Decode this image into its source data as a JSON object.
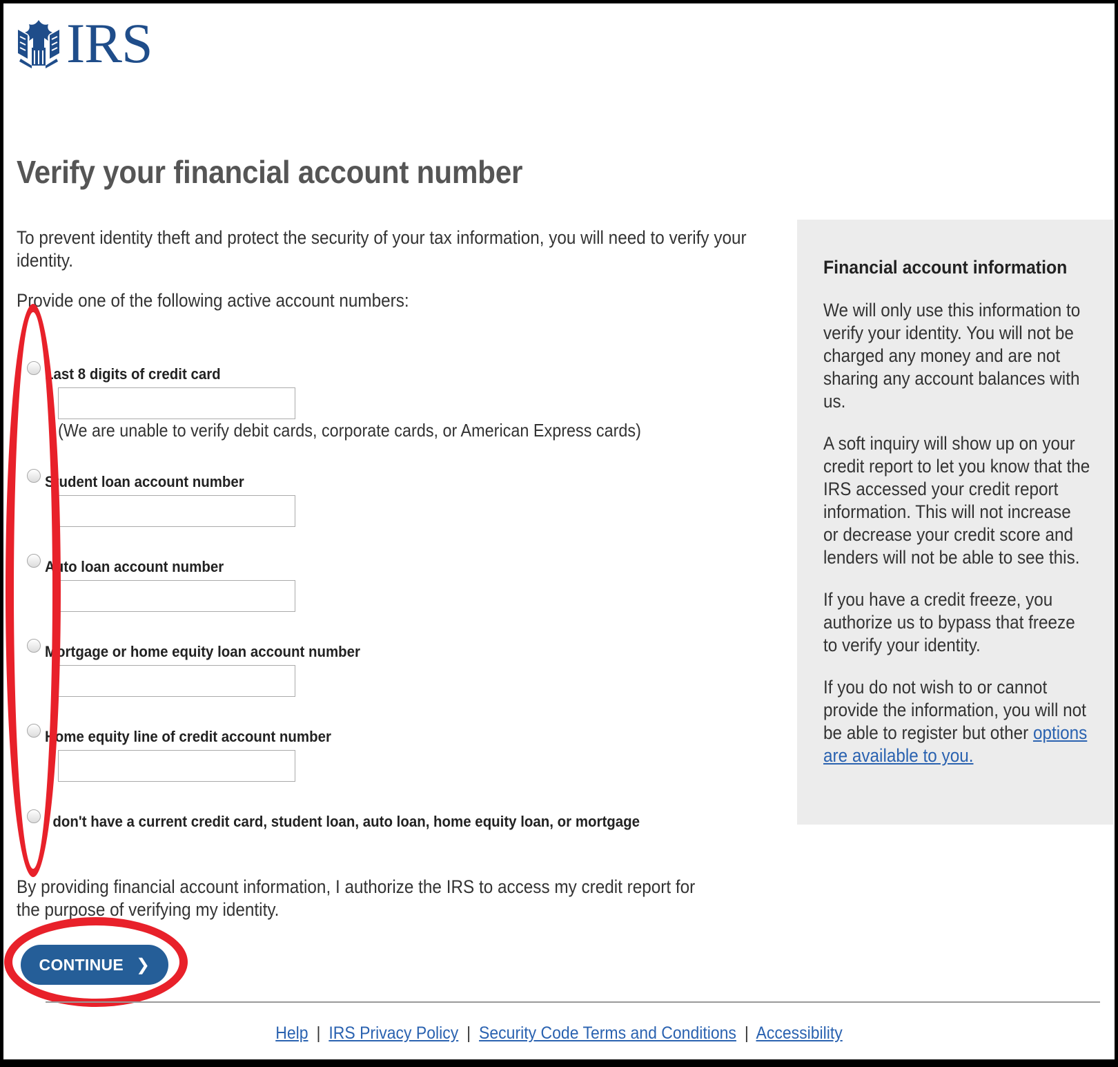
{
  "header": {
    "logo_text": "IRS"
  },
  "page": {
    "title": "Verify your financial account number",
    "intro": "To prevent identity theft and protect the security of your tax information, you will need to verify your identity.",
    "provide_label": "Provide one of the following active account numbers:"
  },
  "options": [
    {
      "label": "Last 8 digits of credit card",
      "input_value": ""
    },
    {
      "label": "Student loan account number",
      "input_value": ""
    },
    {
      "label": "Auto loan account number",
      "input_value": ""
    },
    {
      "label": "Mortgage or home equity loan account number",
      "input_value": ""
    },
    {
      "label": "Home equity line of credit account number",
      "input_value": ""
    },
    {
      "label": "I don't have a current credit card, student loan, auto loan, home equity loan, or mortgage"
    }
  ],
  "credit_card_note": "(We are unable to verify debit cards, corporate cards, or American Express cards)",
  "consent": "By providing financial account information, I authorize the IRS to access my credit report for the purpose of verifying my identity.",
  "continue_label": "CONTINUE",
  "sidebar": {
    "title": "Financial account information",
    "p1": "We will only use this information to verify your identity. You will not be charged any money and are not sharing any account balances with us.",
    "p2": "A soft inquiry will show up on your credit report to let you know that the IRS accessed your credit report information. This will not increase or decrease your credit score and lenders will not be able to see this.",
    "p3": "If you have a credit freeze, you authorize us to bypass that freeze to verify your identity.",
    "p4_prefix": "If you do not wish to or cannot provide the information, you will not be able to register but other ",
    "p4_link": "options are available to you."
  },
  "footer": {
    "links": [
      "Help",
      "IRS Privacy Policy",
      "Security Code Terms and Conditions",
      "Accessibility"
    ],
    "separator": "|"
  },
  "colors": {
    "brand_blue": "#1f4d8a",
    "button_blue": "#255e98",
    "link_blue": "#2a62b0",
    "annotation_red": "#e8212a",
    "sidebar_bg": "#ececec"
  }
}
